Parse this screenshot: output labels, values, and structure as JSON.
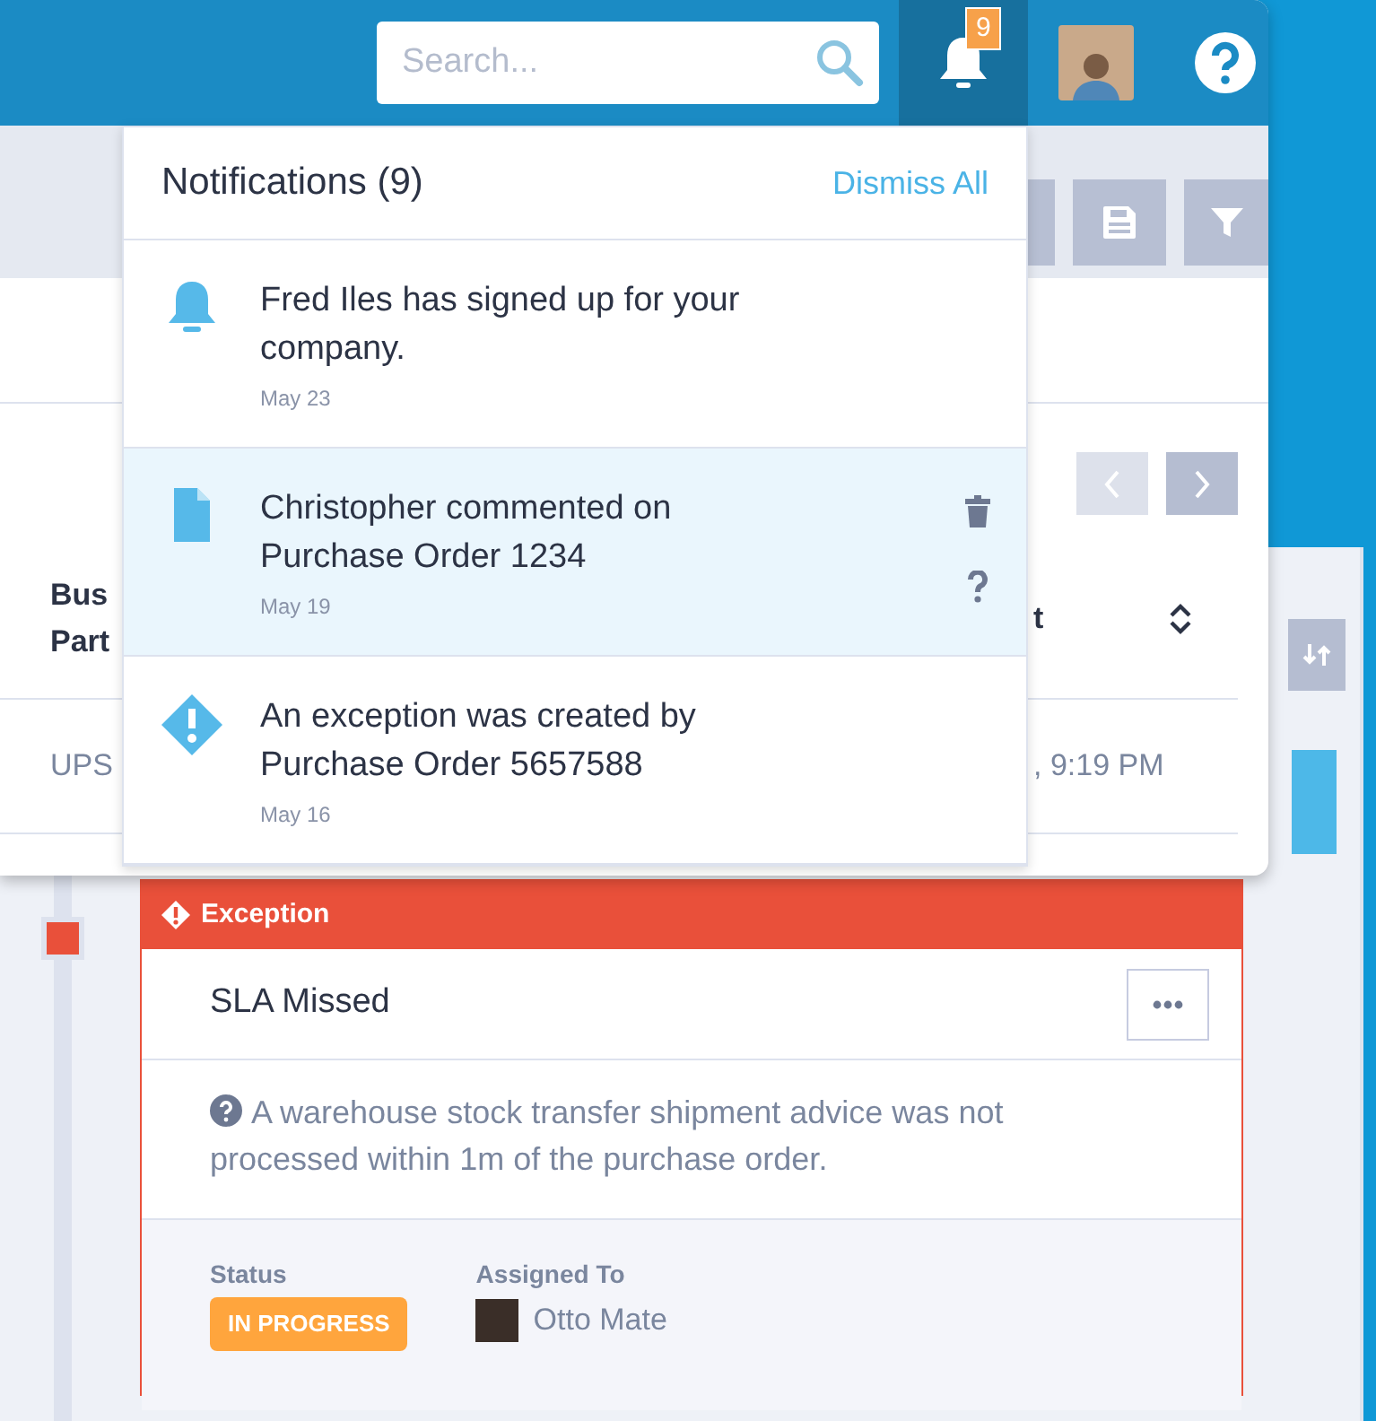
{
  "header": {
    "search": {
      "placeholder": "Search..."
    },
    "notifications_button": {
      "active": true,
      "count": "9"
    }
  },
  "pager": {
    "previous_disabled": true,
    "next_disabled": false
  },
  "table": {
    "columns": [
      {
        "lines": [
          "Bus",
          "Part"
        ]
      },
      {
        "lines": [
          "t"
        ]
      }
    ],
    "rows": [
      [
        [
          "UPS"
        ],
        [
          ", 9:19 PM"
        ]
      ]
    ]
  },
  "notifications": {
    "title": "Notifications (9)",
    "dismiss_label": "Dismiss All",
    "items": [
      {
        "kind": "bell",
        "text": "Fred Iles has signed up for your company.",
        "date": "May 23",
        "selected": false
      },
      {
        "kind": "document",
        "text": "Christopher commented on Purchase Order 1234",
        "date": "May 19",
        "selected": true
      },
      {
        "kind": "exception",
        "text": "An exception was created by Purchase Order 5657588",
        "date": "May 16",
        "selected": false
      }
    ]
  },
  "exception": {
    "header": "Exception",
    "title": "SLA Missed",
    "description": "A warehouse stock transfer shipment advice was not processed within 1m of the purchase order.",
    "status_label": "Status",
    "status": "IN PROGRESS",
    "assigned_label": "Assigned To",
    "assignee": "Otto Mate"
  }
}
